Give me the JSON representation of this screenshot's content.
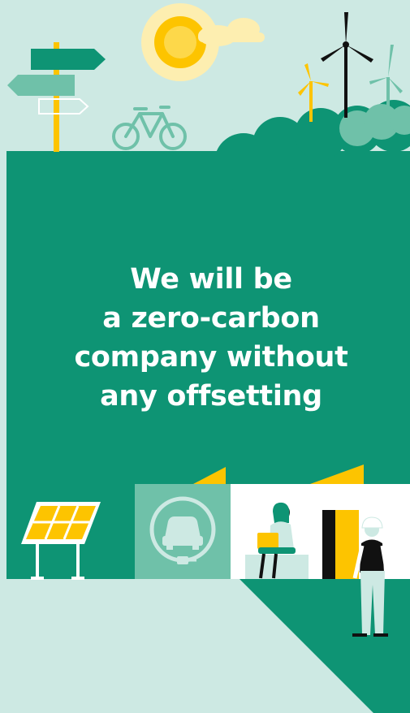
{
  "headline": {
    "lines": [
      "We will be",
      "a zero-carbon",
      "company without",
      "any offsetting"
    ]
  },
  "illustration": {
    "icons": [
      "signpost-icon",
      "sun-icon",
      "cloud-icon",
      "bicycle-icon",
      "wind-turbine-icon",
      "bush-icon",
      "solar-panel-icon",
      "ev-charging-icon",
      "person-with-laptop-icon",
      "worker-with-hard-hat-icon"
    ]
  },
  "colors": {
    "background": "#cde9e3",
    "brand_green": "#0e9474",
    "mint": "#6fc1a9",
    "yellow": "#fdc400",
    "sun_glow": "#fdeeb0",
    "black": "#111111",
    "white": "#ffffff"
  }
}
